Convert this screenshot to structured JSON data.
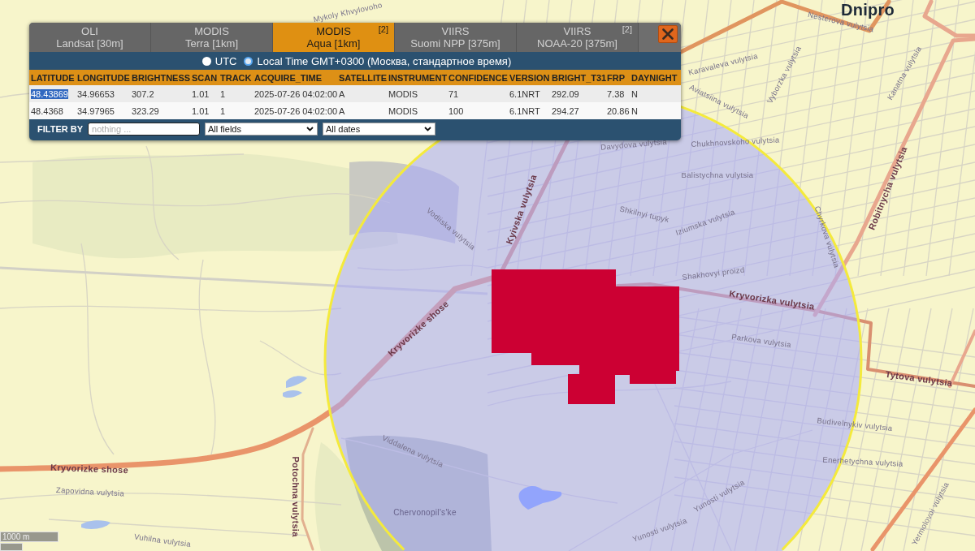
{
  "panel": {
    "tabs": [
      {
        "title": "OLI",
        "subtitle": "Landsat [30m]",
        "selected": false
      },
      {
        "title": "MODIS",
        "subtitle": "Terra [1km]",
        "selected": false
      },
      {
        "title": "MODIS",
        "subtitle": "Aqua [1km]",
        "badge": "[2]",
        "selected": true
      },
      {
        "title": "VIIRS",
        "subtitle": "Suomi NPP [375m]",
        "selected": false
      },
      {
        "title": "VIIRS",
        "subtitle": "NOAA-20 [375m]",
        "badge": "[2]",
        "selected": false
      }
    ],
    "time_modes": [
      {
        "label": "UTC",
        "selected": false
      },
      {
        "label": "Local Time GMT+0300 (Москва, стандартное время)",
        "selected": true
      }
    ],
    "table": {
      "columns": [
        "LATITUDE",
        "LONGITUDE",
        "BRIGHTNESS",
        "SCAN",
        "TRACK",
        "ACQUIRE_TIME",
        "SATELLITE",
        "INSTRUMENT",
        "CONFIDENCE",
        "VERSION",
        "BRIGHT_T31",
        "FRP",
        "DAYNIGHT"
      ],
      "rows": [
        {
          "cells": [
            {
              "text": "48.43869",
              "selected": true
            },
            {
              "text": "34.96653",
              "selected": false
            },
            {
              "text": "307.2",
              "selected": false
            },
            {
              "text": "1.01",
              "selected": false
            },
            {
              "text": "1",
              "selected": false
            },
            {
              "text": "2025-07-26 04:02:00",
              "selected": false
            },
            {
              "text": "A",
              "selected": false
            },
            {
              "text": "MODIS",
              "selected": false
            },
            {
              "text": "71",
              "selected": false
            },
            {
              "text": "6.1NRT",
              "selected": false
            },
            {
              "text": "292.09",
              "selected": false
            },
            {
              "text": "7.38",
              "selected": false
            },
            {
              "text": "N",
              "selected": false
            }
          ]
        },
        {
          "cells": [
            {
              "text": "48.4368",
              "selected": false
            },
            {
              "text": "34.97965",
              "selected": false
            },
            {
              "text": "323.29",
              "selected": false
            },
            {
              "text": "1.01",
              "selected": false
            },
            {
              "text": "1",
              "selected": false
            },
            {
              "text": "2025-07-26 04:02:00",
              "selected": false
            },
            {
              "text": "A",
              "selected": false
            },
            {
              "text": "MODIS",
              "selected": false
            },
            {
              "text": "100",
              "selected": false
            },
            {
              "text": "6.1NRT",
              "selected": false
            },
            {
              "text": "294.27",
              "selected": false
            },
            {
              "text": "20.86",
              "selected": false
            },
            {
              "text": "N",
              "selected": false
            }
          ]
        }
      ]
    },
    "filter": {
      "label": "FILTER BY",
      "placeholder": "nothing ...",
      "field_select": "All fields",
      "date_select": "All dates"
    }
  },
  "map": {
    "labels": [
      {
        "text": "Dnipro",
        "kind": "city"
      },
      {
        "text": "Mykoly Khvylovoho",
        "kind": "street"
      },
      {
        "text": "Nesterova vulytsia",
        "kind": "street"
      },
      {
        "text": "Karavaleva vulytsia",
        "kind": "street"
      },
      {
        "text": "Vyborzka vulytsia",
        "kind": "street"
      },
      {
        "text": "Aviatsiina vulytsia",
        "kind": "street"
      },
      {
        "text": "Kanatna vulytsia",
        "kind": "street"
      },
      {
        "text": "Davydova vulytsia",
        "kind": "street"
      },
      {
        "text": "Chukhnovskoho vulytsia",
        "kind": "street"
      },
      {
        "text": "Balistychna vulytsia",
        "kind": "street"
      },
      {
        "text": "Kyivska vulytsia",
        "kind": "road"
      },
      {
        "text": "Vodiiska vulytsia",
        "kind": "street"
      },
      {
        "text": "Shkilnyi tupyk",
        "kind": "street"
      },
      {
        "text": "Iziumska vulytsia",
        "kind": "street"
      },
      {
        "text": "Chyrkova vulytsia",
        "kind": "street"
      },
      {
        "text": "Robitnycha vulytsia",
        "kind": "road"
      },
      {
        "text": "Shakhovyi proizd",
        "kind": "street"
      },
      {
        "text": "Kryvorizka vulytsia",
        "kind": "road"
      },
      {
        "text": "Kryvorizke shose",
        "kind": "road"
      },
      {
        "text": "Parkova vulytsia",
        "kind": "street"
      },
      {
        "text": "Tytova vulytsia",
        "kind": "road"
      },
      {
        "text": "Budivelnykiv vulytsia",
        "kind": "street"
      },
      {
        "text": "Enerhetychna vulytsia",
        "kind": "street"
      },
      {
        "text": "Viddalena vulytsia",
        "kind": "street"
      },
      {
        "text": "Kryvorizke shose",
        "kind": "road"
      },
      {
        "text": "Zapovidna vulytsia",
        "kind": "street"
      },
      {
        "text": "Potochna vulytsia",
        "kind": "road"
      },
      {
        "text": "Chervonopil's'ke",
        "kind": "place"
      },
      {
        "text": "Yunosti vulytsia",
        "kind": "street"
      },
      {
        "text": "Yunosti vulytsia",
        "kind": "street"
      },
      {
        "text": "Yermolovoi vulytsia",
        "kind": "street"
      },
      {
        "text": "Vuhilna vulytsia",
        "kind": "street"
      }
    ],
    "scale": "1000 m"
  }
}
